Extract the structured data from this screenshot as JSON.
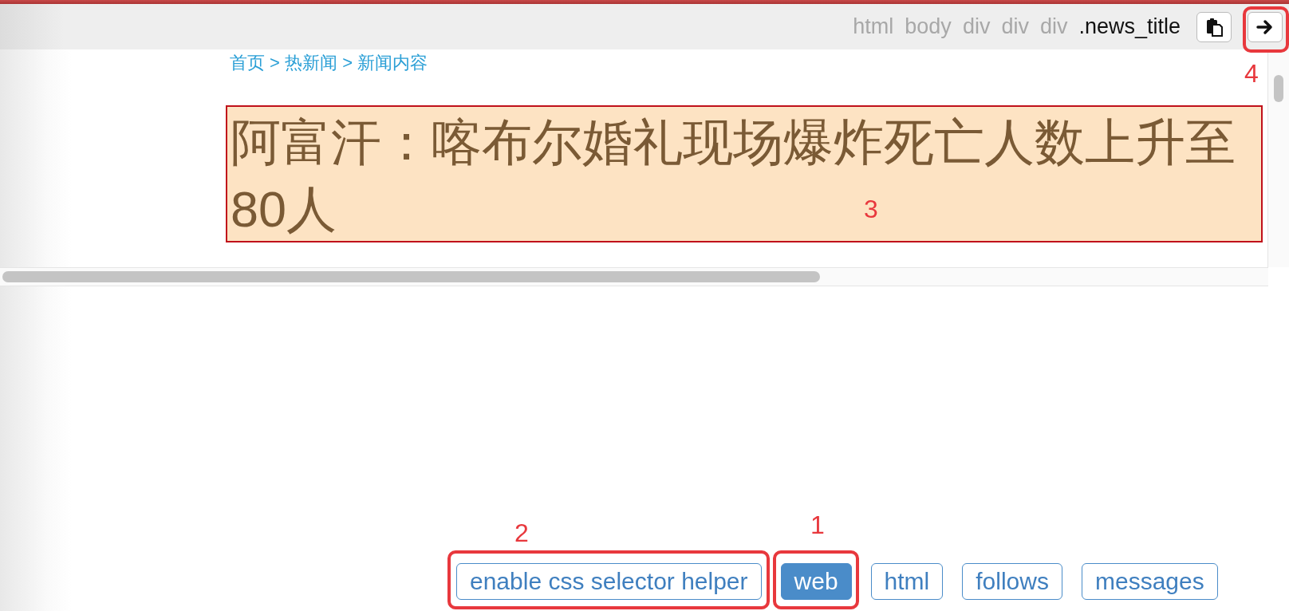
{
  "toolbar": {
    "path": [
      {
        "label": "html",
        "selected": false
      },
      {
        "label": "body",
        "selected": false
      },
      {
        "label": "div",
        "selected": false
      },
      {
        "label": "div",
        "selected": false
      },
      {
        "label": "div",
        "selected": false
      },
      {
        "label": ".news_title",
        "selected": true
      }
    ]
  },
  "breadcrumb": "首页 > 热新闻 > 新闻内容",
  "title": "阿富汗：喀布尔婚礼现场爆炸死亡人数上升至80人",
  "bottom_buttons": [
    {
      "label": "enable css selector helper",
      "selected": false
    },
    {
      "label": "web",
      "selected": true
    },
    {
      "label": "html",
      "selected": false
    },
    {
      "label": "follows",
      "selected": false
    },
    {
      "label": "messages",
      "selected": false
    }
  ],
  "annotations": [
    {
      "label": "4"
    },
    {
      "label": "3"
    },
    {
      "label": "2"
    },
    {
      "label": "1"
    }
  ]
}
